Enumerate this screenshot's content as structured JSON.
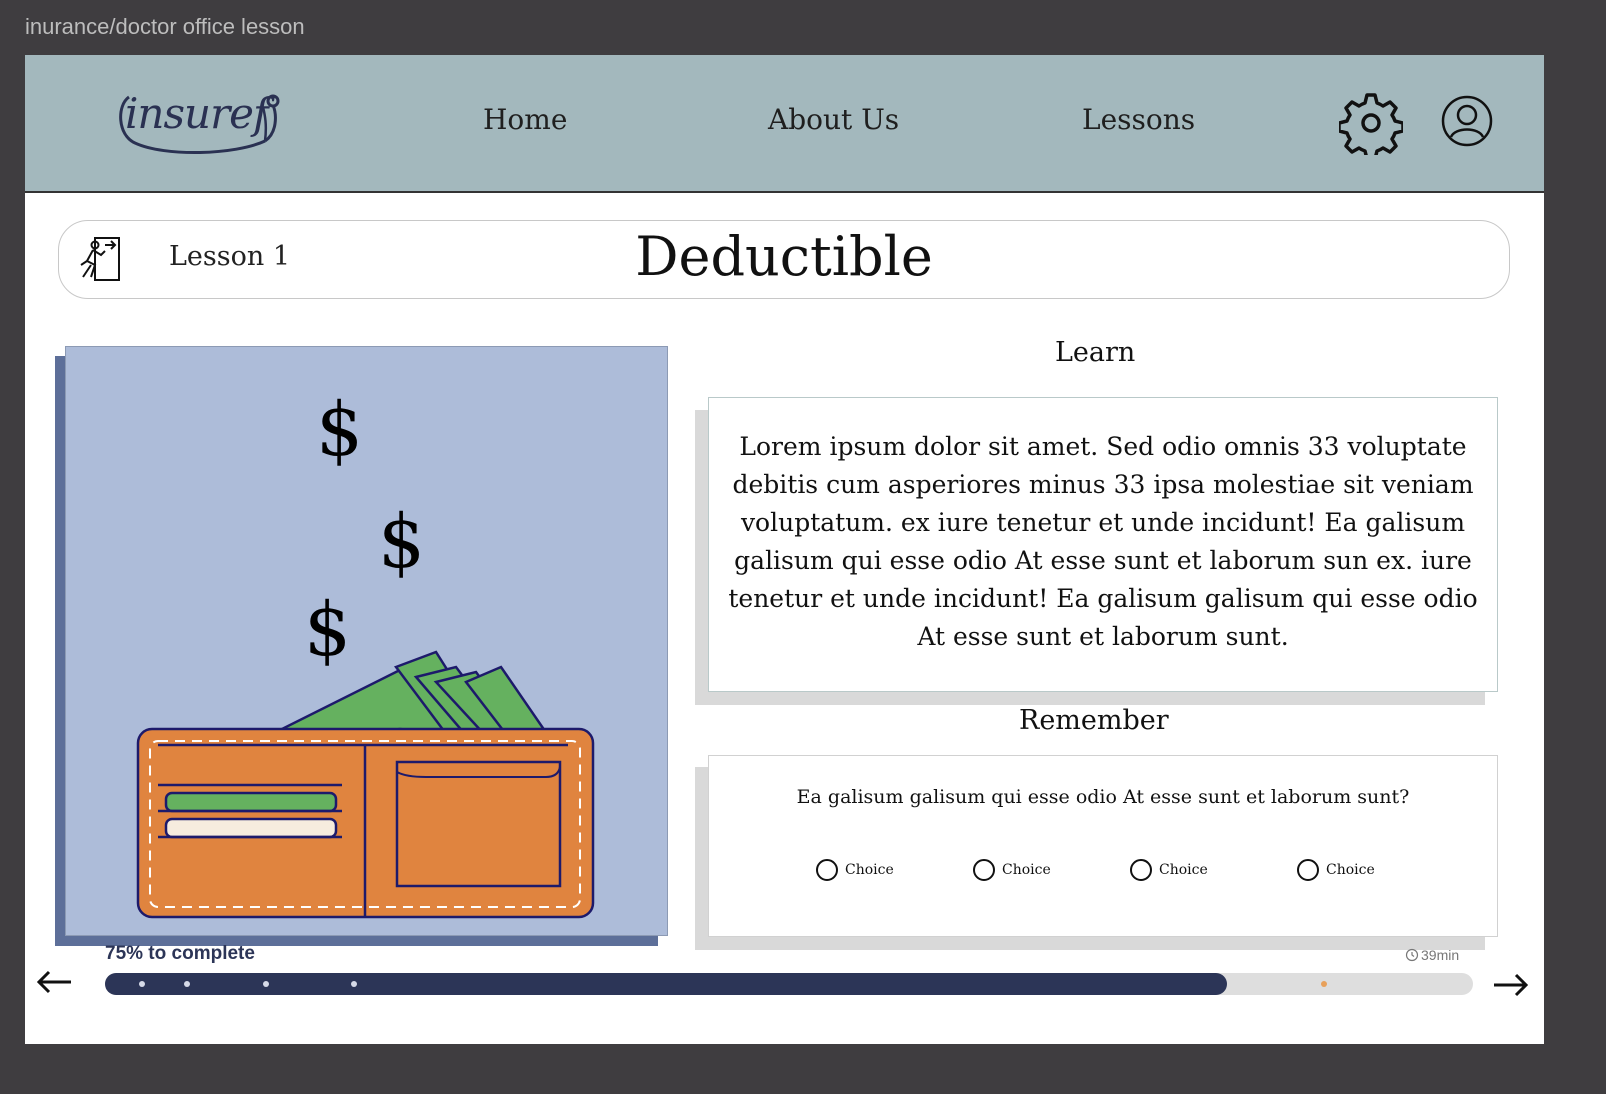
{
  "window": {
    "title": "inurance/doctor office lesson"
  },
  "header": {
    "logo_text": "insuref",
    "nav": [
      {
        "label": "Home"
      },
      {
        "label": "About Us"
      },
      {
        "label": "Lessons"
      }
    ],
    "icons": [
      "gear-icon",
      "user-icon"
    ]
  },
  "lesson": {
    "number_label": "Lesson 1",
    "title": "Deductible",
    "exit_icon": "exit-icon"
  },
  "illustration": {
    "symbols": [
      "$",
      "$",
      "$"
    ],
    "wallet_colors": {
      "wallet": "#e0843f",
      "cash": "#65b15f",
      "outline": "#1d1a6b",
      "background": "#adbcd9"
    }
  },
  "learn": {
    "label": "Learn",
    "text": "Lorem ipsum dolor sit amet. Sed odio omnis 33 voluptate debitis cum asperiores minus 33 ipsa molestiae sit veniam voluptatum.   ex iure tenetur et unde incidunt! Ea galisum galisum qui esse odio At esse sunt et laborum sun ex. iure tenetur et unde incidunt! Ea galisum galisum qui esse odio At esse sunt et laborum sunt."
  },
  "remember": {
    "label": "Remember",
    "question": "Ea galisum galisum qui esse odio At esse sunt et laborum sunt?",
    "choices": [
      "Choice",
      "Choice",
      "Choice",
      "Choice"
    ]
  },
  "progress": {
    "label": "75% to complete",
    "fraction": 0.82,
    "time": "39min",
    "colors": {
      "fill": "#2c3557",
      "track": "#dedede",
      "marker": "#e8a15b"
    }
  }
}
